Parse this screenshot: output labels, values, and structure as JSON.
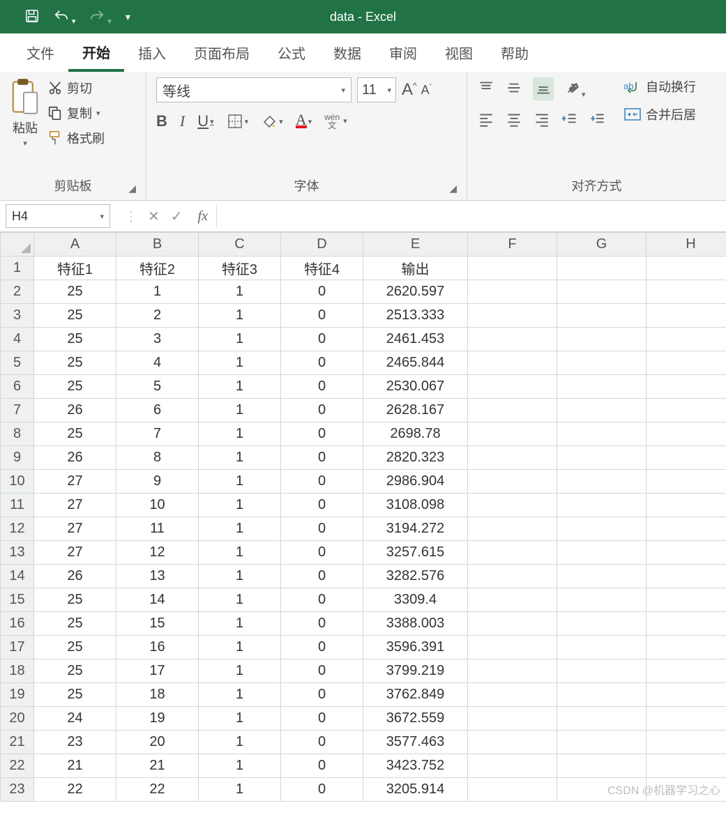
{
  "title": "data  -  Excel",
  "qat": {
    "save": "save-icon",
    "undo": "undo-icon",
    "redo": "redo-icon",
    "customize": "customize-icon"
  },
  "tabs": [
    "文件",
    "开始",
    "插入",
    "页面布局",
    "公式",
    "数据",
    "审阅",
    "视图",
    "帮助"
  ],
  "active_tab_index": 1,
  "clipboard": {
    "paste": "粘贴",
    "cut": "剪切",
    "copy": "复制",
    "format_painter": "格式刷",
    "group": "剪贴板"
  },
  "font": {
    "name": "等线",
    "size": "11",
    "group": "字体",
    "bold": "B",
    "italic": "I",
    "underline": "U",
    "phonetic": "wén\n文"
  },
  "alignment": {
    "group": "对齐方式",
    "wrap": "自动换行",
    "merge": "合并后居"
  },
  "namebox": "H4",
  "fx_label": "fx",
  "columns": [
    "A",
    "B",
    "C",
    "D",
    "E",
    "F",
    "G",
    "H"
  ],
  "headers": [
    "特征1",
    "特征2",
    "特征3",
    "特征4",
    "输出"
  ],
  "rows": [
    [
      "25",
      "1",
      "1",
      "0",
      "2620.597"
    ],
    [
      "25",
      "2",
      "1",
      "0",
      "2513.333"
    ],
    [
      "25",
      "3",
      "1",
      "0",
      "2461.453"
    ],
    [
      "25",
      "4",
      "1",
      "0",
      "2465.844"
    ],
    [
      "25",
      "5",
      "1",
      "0",
      "2530.067"
    ],
    [
      "26",
      "6",
      "1",
      "0",
      "2628.167"
    ],
    [
      "25",
      "7",
      "1",
      "0",
      "2698.78"
    ],
    [
      "26",
      "8",
      "1",
      "0",
      "2820.323"
    ],
    [
      "27",
      "9",
      "1",
      "0",
      "2986.904"
    ],
    [
      "27",
      "10",
      "1",
      "0",
      "3108.098"
    ],
    [
      "27",
      "11",
      "1",
      "0",
      "3194.272"
    ],
    [
      "27",
      "12",
      "1",
      "0",
      "3257.615"
    ],
    [
      "26",
      "13",
      "1",
      "0",
      "3282.576"
    ],
    [
      "25",
      "14",
      "1",
      "0",
      "3309.4"
    ],
    [
      "25",
      "15",
      "1",
      "0",
      "3388.003"
    ],
    [
      "25",
      "16",
      "1",
      "0",
      "3596.391"
    ],
    [
      "25",
      "17",
      "1",
      "0",
      "3799.219"
    ],
    [
      "25",
      "18",
      "1",
      "0",
      "3762.849"
    ],
    [
      "24",
      "19",
      "1",
      "0",
      "3672.559"
    ],
    [
      "23",
      "20",
      "1",
      "0",
      "3577.463"
    ],
    [
      "21",
      "21",
      "1",
      "0",
      "3423.752"
    ],
    [
      "22",
      "22",
      "1",
      "0",
      "3205.914"
    ]
  ],
  "watermark": "CSDN @机器学习之心"
}
